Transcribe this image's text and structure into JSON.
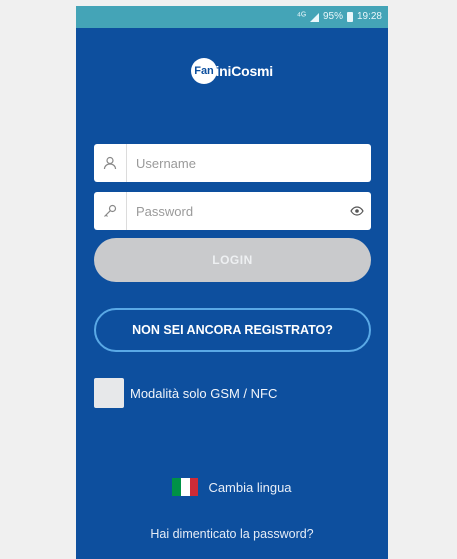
{
  "status_bar": {
    "network": "⁴ᴳ",
    "battery": "95%",
    "time": "19:28"
  },
  "logo": {
    "circle_text": "Fan",
    "text": "tiniCosmi"
  },
  "form": {
    "username_placeholder": "Username",
    "password_placeholder": "Password",
    "username_icon": "user-icon",
    "password_icon": "key-icon",
    "eye_icon": "eye-icon"
  },
  "buttons": {
    "login_label": "LOGIN",
    "register_label": "NON SEI ANCORA REGISTRATO?"
  },
  "gsm_mode": {
    "label": "Modalità solo GSM / NFC"
  },
  "language": {
    "label": "Cambia lingua",
    "flag_colors": [
      "#009246",
      "#ffffff",
      "#ce2b37"
    ]
  },
  "forgot_password": "Hai dimenticato la password?",
  "colors": {
    "background": "#0d4f9e",
    "status_bar": "#44a4b7",
    "login_button": "#c9cacc",
    "register_border": "#5aa9e6"
  }
}
